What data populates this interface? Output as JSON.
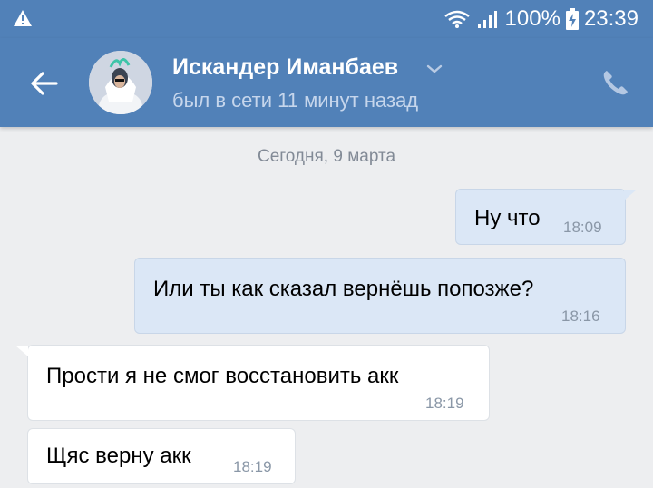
{
  "status_bar": {
    "battery": "100%",
    "time": "23:39",
    "icons": [
      "warning-icon",
      "wifi-icon",
      "signal-icon",
      "battery-charging-icon"
    ]
  },
  "header": {
    "contact_name": "Искандер Иманбаев",
    "last_seen": "был в сети 11 минут назад",
    "icons": [
      "back-arrow-icon",
      "chevron-down-icon",
      "phone-icon"
    ],
    "colors": {
      "bar": "#5181b8",
      "background": "#edeef0"
    }
  },
  "chat": {
    "date_separator": "Сегодня, 9 марта",
    "messages": [
      {
        "direction": "outgoing",
        "text": "Ну что",
        "time": "18:09"
      },
      {
        "direction": "outgoing",
        "text": "Или ты как сказал вернёшь попозже?",
        "time": "18:16"
      },
      {
        "direction": "incoming",
        "text": "Прости я не смог восстановить акк",
        "time": "18:19"
      },
      {
        "direction": "incoming",
        "text": "Щяс верну акк",
        "time": "18:19"
      }
    ]
  }
}
